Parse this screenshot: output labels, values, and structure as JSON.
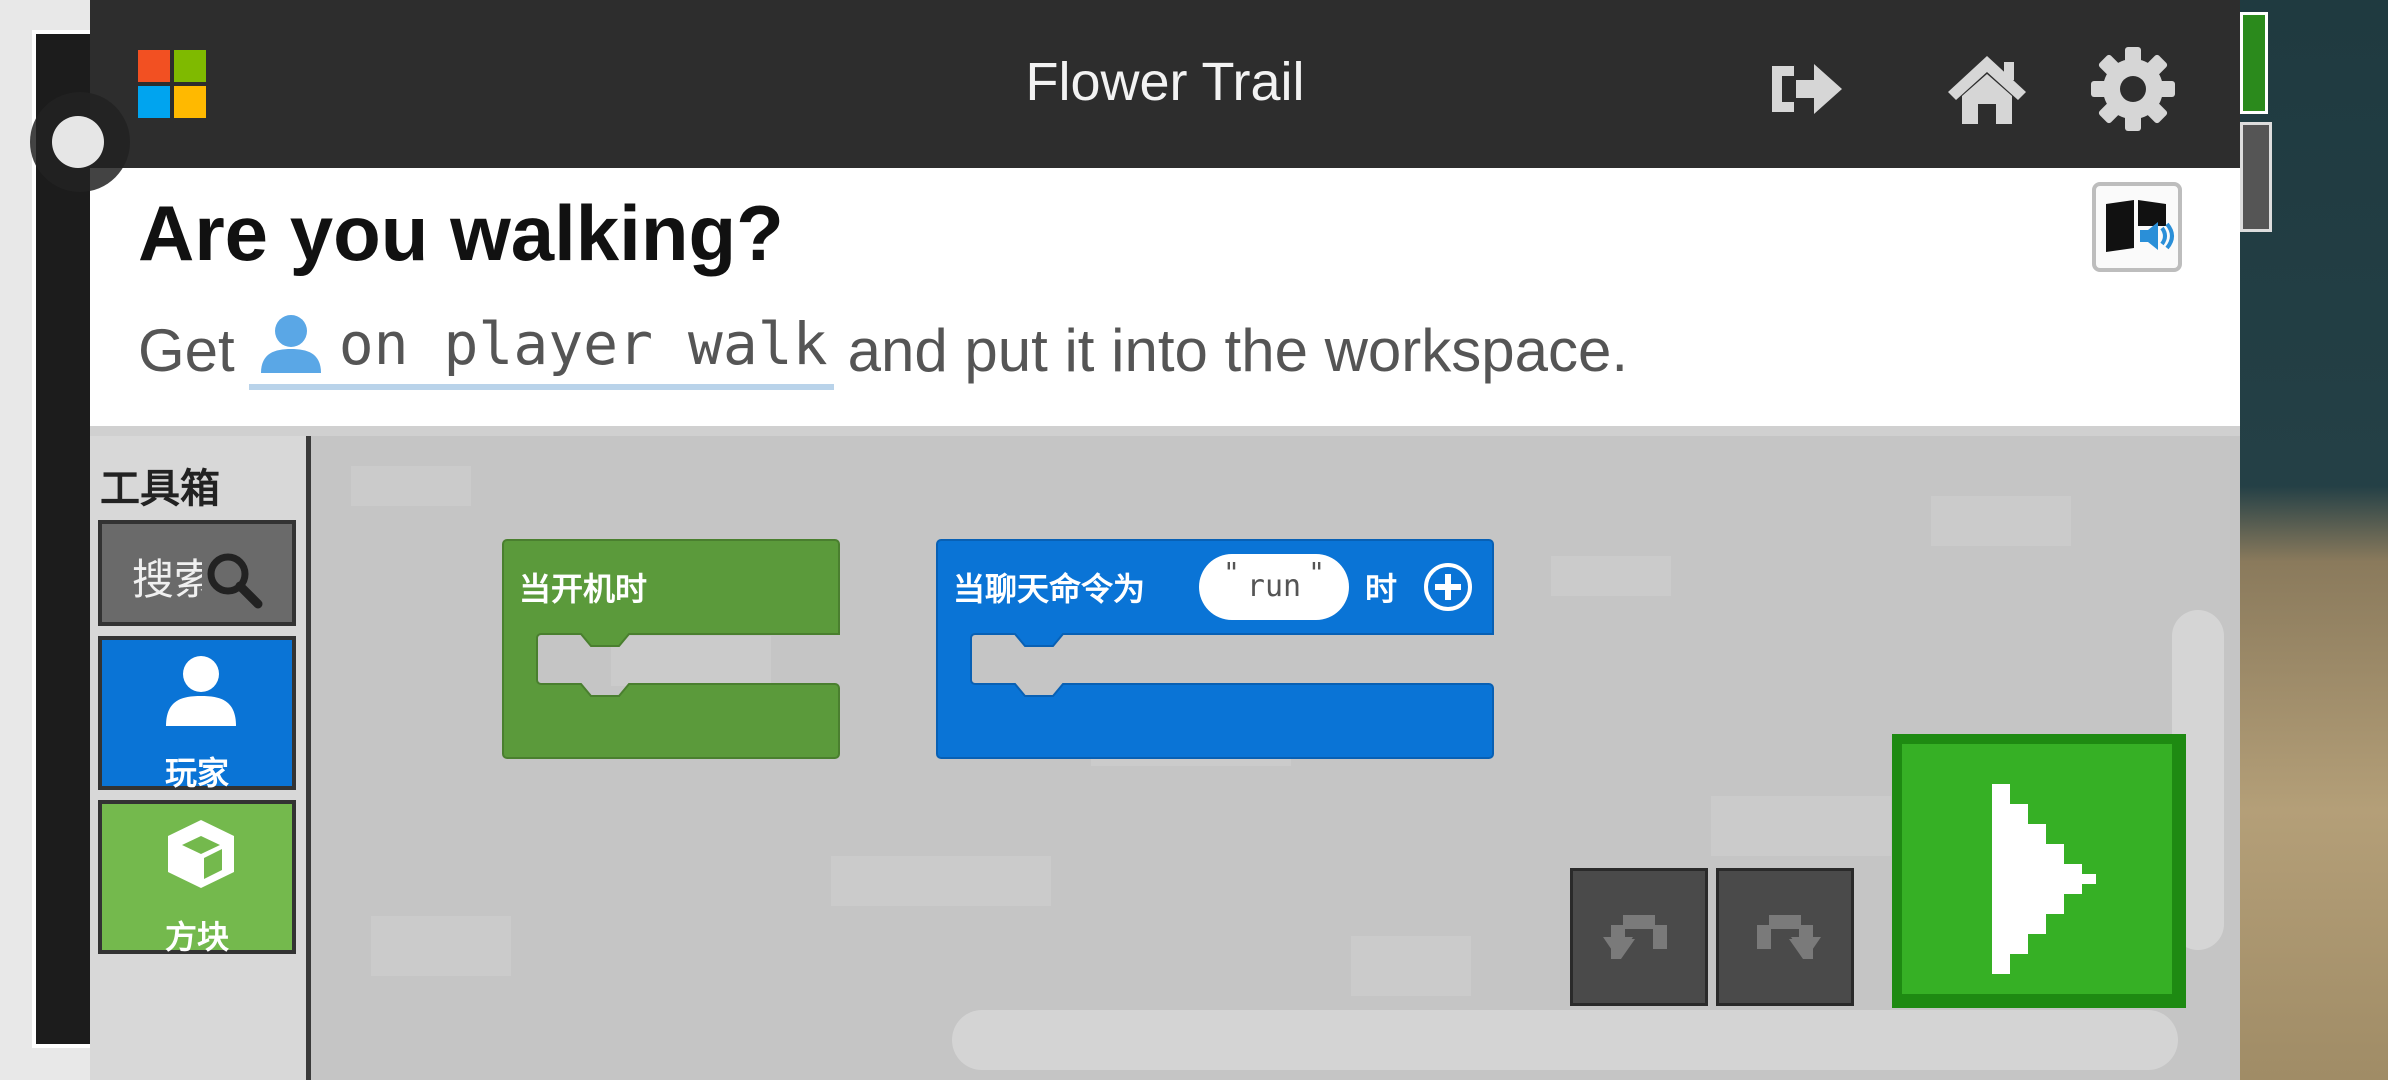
{
  "app": {
    "title": "Flower Trail"
  },
  "instruction": {
    "heading": "Are you walking?",
    "prefix": "Get",
    "code_chip": "on player walk",
    "suffix": "and put it into the workspace."
  },
  "toolbox": {
    "title": "工具箱",
    "search_placeholder": "搜索",
    "categories": [
      {
        "label": "玩家",
        "icon": "player-icon",
        "color": "#0a74d6"
      },
      {
        "label": "方块",
        "icon": "cube-icon",
        "color": "#74b94d"
      }
    ]
  },
  "workspace": {
    "blocks": [
      {
        "label": "当开机时",
        "color": "#5b9a3b"
      },
      {
        "label_before": "当聊天命令为",
        "value": "run",
        "label_after": "时",
        "color": "#0a74d6"
      }
    ]
  },
  "colors": {
    "titlebar": "#2d2d2d",
    "run_button": "#36b025",
    "ms_logo": [
      "#f25022",
      "#7fba00",
      "#00a4ef",
      "#ffb900"
    ]
  }
}
